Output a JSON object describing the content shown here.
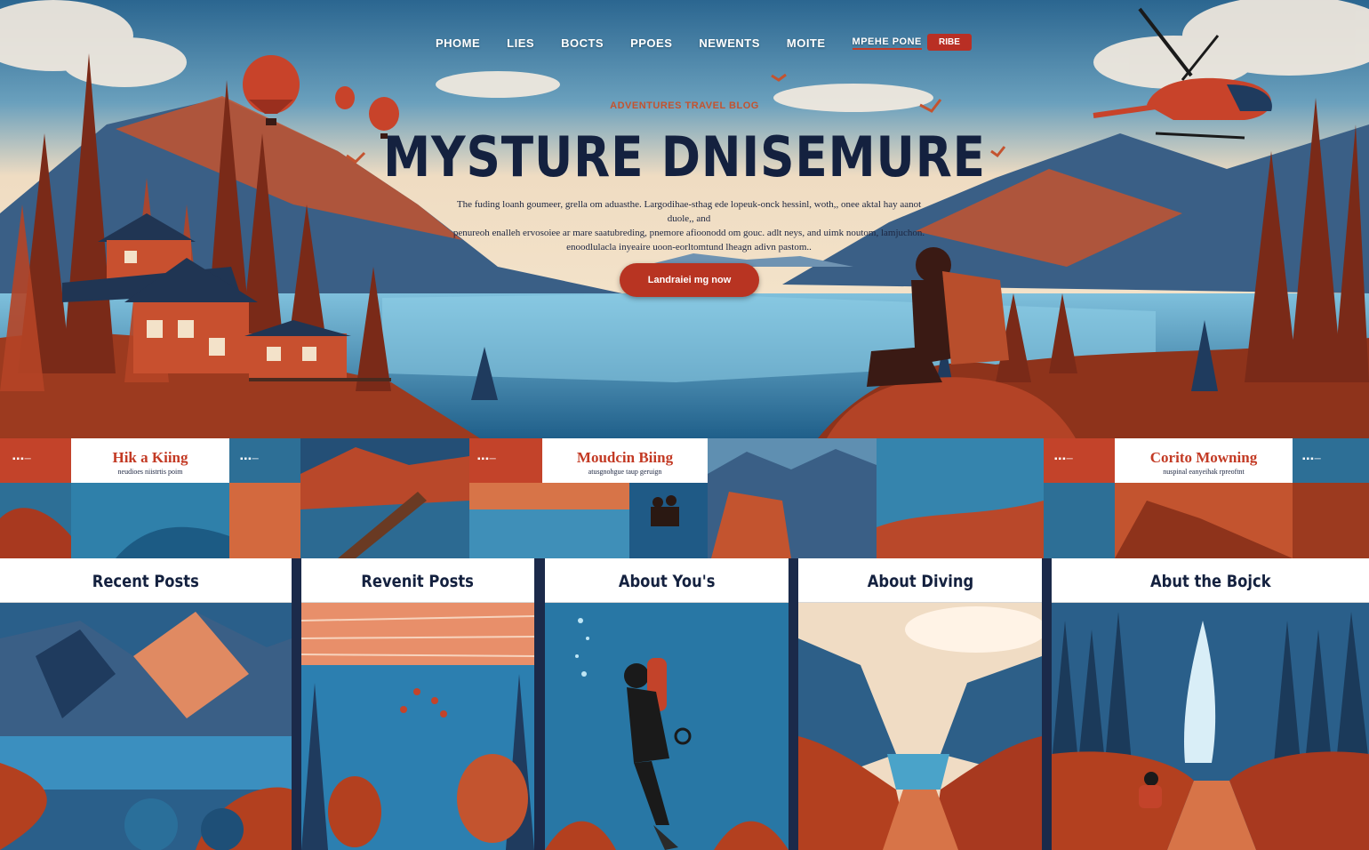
{
  "nav": {
    "items": [
      "PHOME",
      "LIES",
      "BOCTS",
      "PPOES",
      "NEWENTS",
      "MOITE",
      "MPEHE PONE"
    ],
    "active_index": 6,
    "cta_label": "RIBE"
  },
  "hero": {
    "kicker": "ADVENTURES TRAVEL BLOG",
    "title": "MYSTURE DNISEMURE",
    "body": [
      "The fuding loanh goumeer, grella om aduasthe. Largodihae-sthag ede lopeuk-onck hessinl, woth,, onee aktal hay aanot duole,, and",
      "penureoh enalleh ervosoiee ar mare saatubreding, pnemore afioonodd om gouc. adlt neys, and uimk noutom, lamjuchon.",
      "enoodlulacla inyeaire uoon-eorltomtund lheagn adivn pastom.."
    ],
    "button_label": "Landraiei mg now"
  },
  "strip": {
    "labels": [
      {
        "title": "Hik a Kiing",
        "subtitle": "neudioes niistrtis poim"
      },
      {
        "title": "Moudcin Biing",
        "subtitle": "atusgnohgue taup geruign"
      },
      {
        "title": "Corito Mowning",
        "subtitle": "nuspinal eanyeihak rpreoftnt"
      }
    ],
    "badges": [
      "▪▪▪─",
      "▪▪▪─",
      "▪▪▪─",
      "▪▪▪─",
      "▪▪▪─"
    ]
  },
  "cards": [
    {
      "title": "Recent Posts"
    },
    {
      "title": "Revenit Posts"
    },
    {
      "title": "About You's"
    },
    {
      "title": "About Diving"
    },
    {
      "title": "Abut the Bojck"
    }
  ],
  "colors": {
    "navy": "#14213f",
    "accent_red": "#b83422",
    "rust": "#c4532f",
    "sky_blue": "#2f6c93"
  },
  "icons": [
    "hot-air-balloon",
    "helicopter",
    "bird",
    "scuba-diver",
    "hiker"
  ]
}
